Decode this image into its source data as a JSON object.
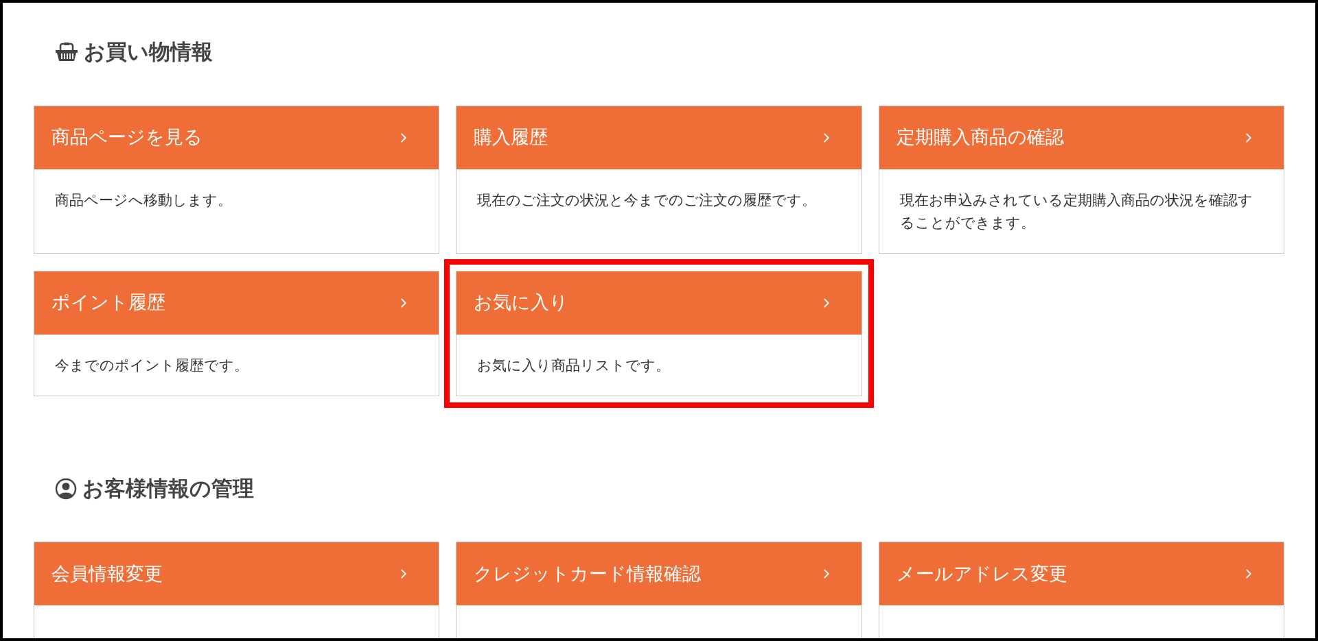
{
  "sections": [
    {
      "kind": "basket",
      "title": "お買い物情報",
      "cards": [
        {
          "title": "商品ページを見る",
          "description": "商品ページへ移動します。",
          "highlighted": false
        },
        {
          "title": "購入履歴",
          "description": "現在のご注文の状況と今までのご注文の履歴です。",
          "highlighted": false
        },
        {
          "title": "定期購入商品の確認",
          "description": "現在お申込みされている定期購入商品の状況を確認することができます。",
          "highlighted": false
        },
        {
          "title": "ポイント履歴",
          "description": "今までのポイント履歴です。",
          "highlighted": false
        },
        {
          "title": "お気に入り",
          "description": "お気に入り商品リストです。",
          "highlighted": true
        }
      ]
    },
    {
      "kind": "user",
      "title": "お客様情報の管理",
      "cards": [
        {
          "title": "会員情報変更",
          "highlighted": false
        },
        {
          "title": "クレジットカード情報確認",
          "highlighted": false
        },
        {
          "title": "メールアドレス変更",
          "highlighted": false
        }
      ]
    }
  ]
}
